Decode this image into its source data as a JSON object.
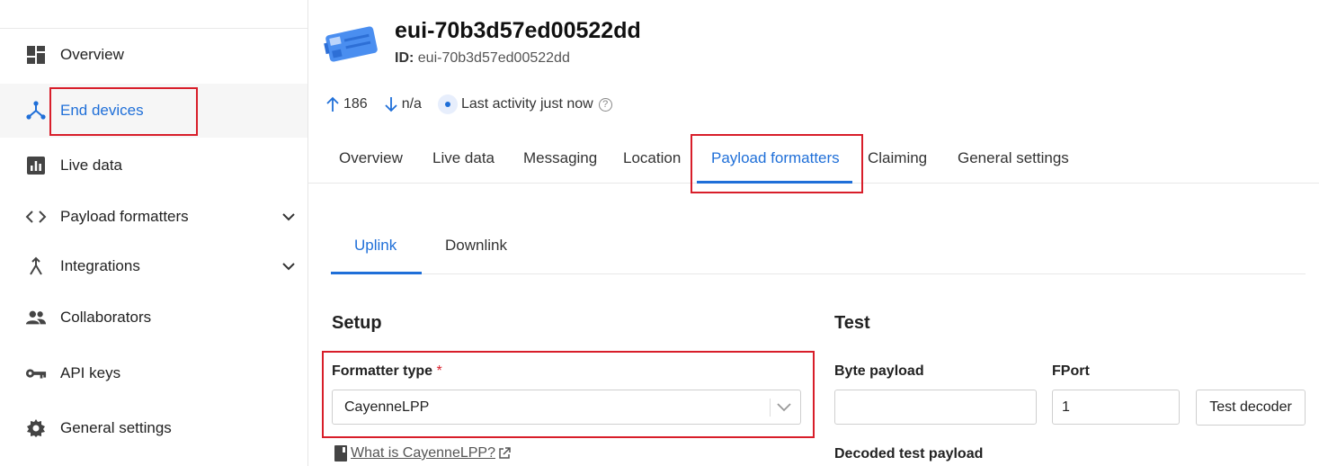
{
  "sidebar": {
    "items": [
      {
        "label": "Overview",
        "icon": "dashboard-icon"
      },
      {
        "label": "End devices",
        "icon": "device-network-icon"
      },
      {
        "label": "Live data",
        "icon": "bar-chart-icon"
      },
      {
        "label": "Payload formatters",
        "icon": "code-icon"
      },
      {
        "label": "Integrations",
        "icon": "merge-icon"
      },
      {
        "label": "Collaborators",
        "icon": "people-icon"
      },
      {
        "label": "API keys",
        "icon": "key-icon"
      },
      {
        "label": "General settings",
        "icon": "gear-icon"
      }
    ]
  },
  "device": {
    "title": "eui-70b3d57ed00522dd",
    "id_label": "ID:",
    "id_value": "eui-70b3d57ed00522dd",
    "uplink_count": "186",
    "downlink_count": "n/a",
    "activity": "Last activity just now"
  },
  "tabs": [
    "Overview",
    "Live data",
    "Messaging",
    "Location",
    "Payload formatters",
    "Claiming",
    "General settings"
  ],
  "subtabs": [
    "Uplink",
    "Downlink"
  ],
  "setup": {
    "title": "Setup",
    "formatter_label": "Formatter type",
    "required_mark": "*",
    "formatter_value": "CayenneLPP",
    "help_link": "What is CayenneLPP?"
  },
  "test": {
    "title": "Test",
    "byte_payload_label": "Byte payload",
    "byte_payload_value": "",
    "fport_label": "FPort",
    "fport_value": "1",
    "test_button": "Test decoder",
    "decoded_label": "Decoded test payload"
  },
  "colors": {
    "accent": "#1f6fd8",
    "highlight": "#d81e2a"
  }
}
